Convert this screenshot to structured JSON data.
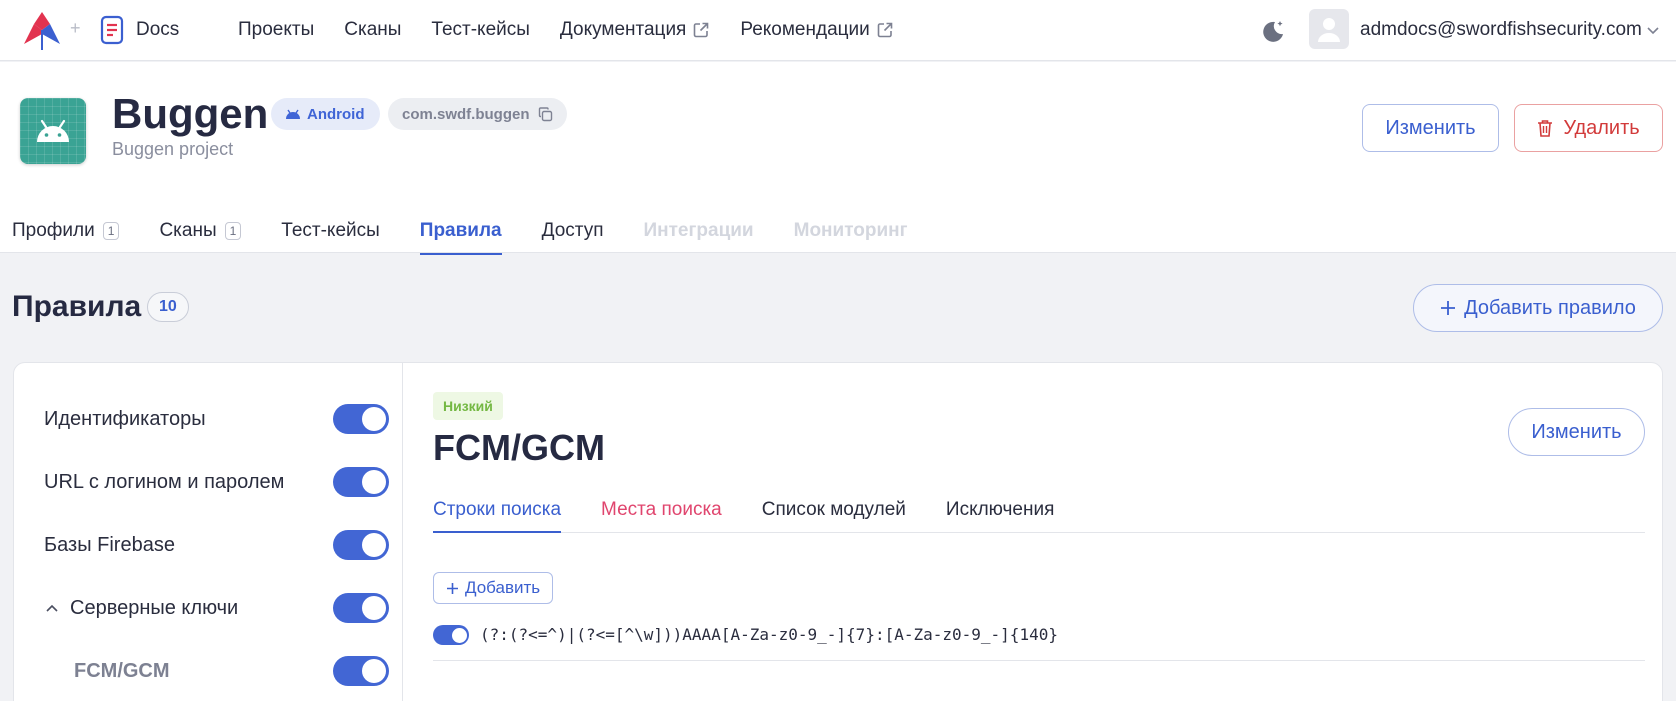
{
  "topbar": {
    "docs_label": "Docs",
    "nav": [
      {
        "label": "Проекты",
        "external": false
      },
      {
        "label": "Сканы",
        "external": false
      },
      {
        "label": "Тест-кейсы",
        "external": false
      },
      {
        "label": "Документация",
        "external": true
      },
      {
        "label": "Рекомендации",
        "external": true
      }
    ],
    "user_email": "admdocs@swordfishsecurity.com"
  },
  "project": {
    "title": "Buggen",
    "subtitle": "Buggen project",
    "platform": "Android",
    "package": "com.swdf.buggen",
    "edit_label": "Изменить",
    "delete_label": "Удалить",
    "tabs": [
      {
        "label": "Профили",
        "count": "1",
        "state": "normal"
      },
      {
        "label": "Сканы",
        "count": "1",
        "state": "normal"
      },
      {
        "label": "Тест-кейсы",
        "count": "",
        "state": "normal"
      },
      {
        "label": "Правила",
        "count": "",
        "state": "active"
      },
      {
        "label": "Доступ",
        "count": "",
        "state": "normal"
      },
      {
        "label": "Интеграции",
        "count": "",
        "state": "disabled"
      },
      {
        "label": "Мониторинг",
        "count": "",
        "state": "disabled"
      }
    ]
  },
  "rules": {
    "heading": "Правила",
    "count": "10",
    "add_label": "Добавить правило",
    "sidebar": [
      {
        "label": "Идентификаторы",
        "enabled": true,
        "child": false,
        "expanded": false
      },
      {
        "label": "URL с логином и паролем",
        "enabled": true,
        "child": false,
        "expanded": false
      },
      {
        "label": "Базы Firebase",
        "enabled": true,
        "child": false,
        "expanded": false
      },
      {
        "label": "Серверные ключи",
        "enabled": true,
        "child": false,
        "expanded": true
      },
      {
        "label": "FCM/GCM",
        "enabled": true,
        "child": true,
        "expanded": false
      }
    ]
  },
  "rule_detail": {
    "severity": "Низкий",
    "title": "FCM/GCM",
    "edit_label": "Изменить",
    "tabs": [
      {
        "label": "Строки поиска",
        "state": "active"
      },
      {
        "label": "Места поиска",
        "state": "warn"
      },
      {
        "label": "Список модулей",
        "state": "normal"
      },
      {
        "label": "Исключения",
        "state": "normal"
      }
    ],
    "add_label": "Добавить",
    "patterns": [
      {
        "enabled": true,
        "text": "(?:(?<=^)|(?<=[^\\w]))AAAA[A-Za-z0-9_-]{7}:[A-Za-z0-9_-]{140}"
      }
    ]
  },
  "colors": {
    "accent": "#3a5fcf",
    "danger": "#d23b3b",
    "severity_low": "#74b843",
    "warn_tab": "#e0456e",
    "project_icon": "#3aa394"
  }
}
